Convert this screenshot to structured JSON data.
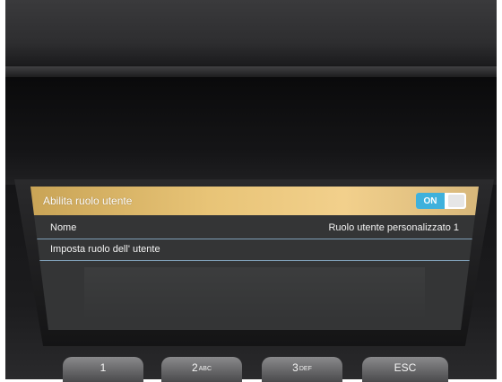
{
  "screen": {
    "title": "Abilita ruolo utente",
    "toggle_label": "ON",
    "rows": [
      {
        "label": "Nome",
        "value": "Ruolo utente personalizzato 1"
      },
      {
        "label": "Imposta ruolo dell' utente",
        "value": ""
      }
    ]
  },
  "keypad": {
    "keys": [
      {
        "digit": "1",
        "letters": ""
      },
      {
        "digit": "2",
        "letters": "ABC"
      },
      {
        "digit": "3",
        "letters": "DEF"
      },
      {
        "digit": "ESC",
        "letters": ""
      }
    ]
  },
  "colors": {
    "titlebar": "#e8c477",
    "toggle_on": "#3fb1dc",
    "screen_bg": "#343536",
    "row_divider": "#7fa0b8"
  }
}
